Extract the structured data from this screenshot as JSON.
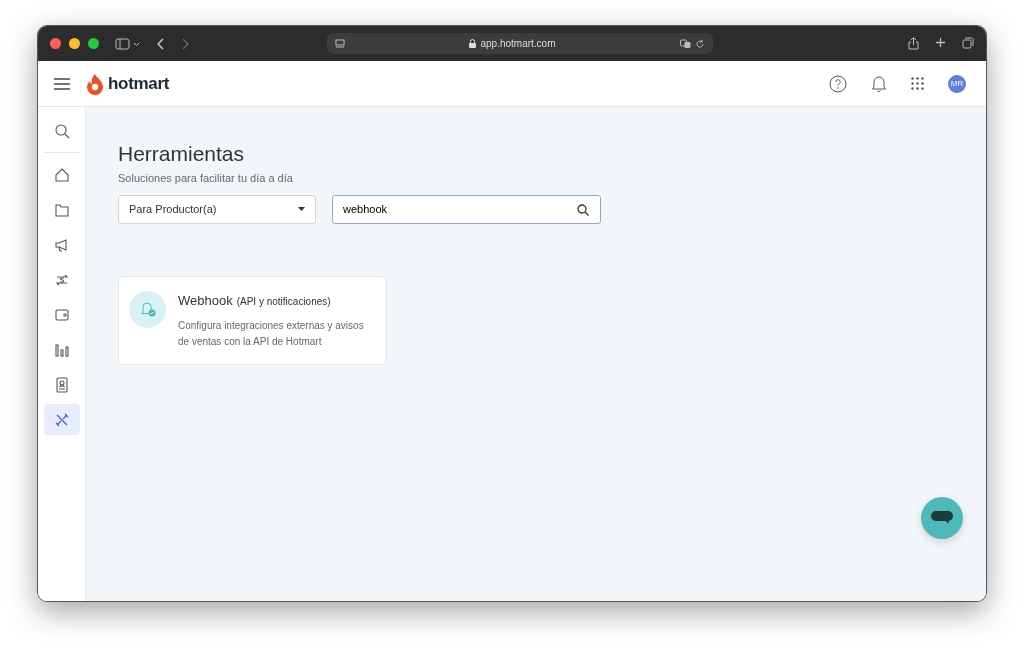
{
  "browser": {
    "url": "app.hotmart.com"
  },
  "header": {
    "logo": "hotmart",
    "avatar": "MR"
  },
  "sidebar": {
    "items": [
      {
        "selected": false
      },
      {
        "selected": false
      },
      {
        "selected": false
      },
      {
        "selected": false
      },
      {
        "selected": false
      },
      {
        "selected": false
      },
      {
        "selected": false
      },
      {
        "selected": false
      },
      {
        "selected": true
      }
    ]
  },
  "page": {
    "title": "Herramientas",
    "subtitle": "Soluciones para facilitar tu día a día"
  },
  "filter": {
    "value": "Para Productor(a)"
  },
  "search": {
    "value": "webhook"
  },
  "results": [
    {
      "title": "Webhook",
      "subtitle": "(API y notificaciones)",
      "description": "Configura integraciones externas y avisos de ventas con la API de Hotmart"
    }
  ]
}
